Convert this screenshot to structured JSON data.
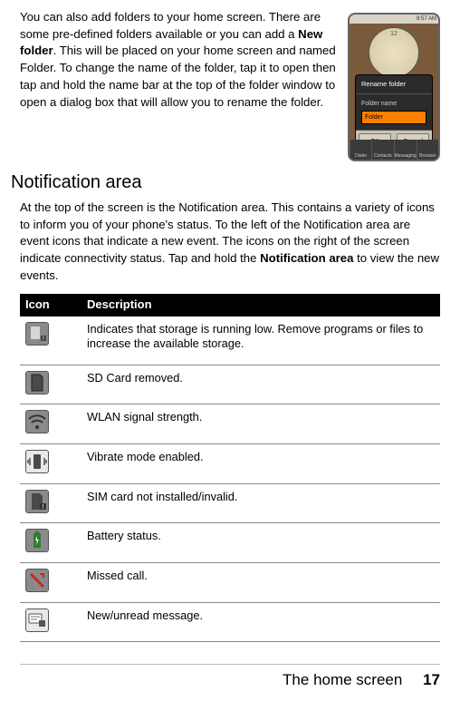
{
  "intro": {
    "text_before_bold": "You can also add folders to your home screen. There are some pre-defined folders available or you can add a ",
    "bold": "New folder",
    "text_after_bold": ". This will be placed on your home screen and named Folder. To change the name of the folder, tap it to open then tap and hold the name bar at the top of the folder window to open a dialog box that will allow you to rename the folder."
  },
  "heading": "Notification area",
  "body": {
    "text_before_bold": "At the top of the screen is the Notification area. This contains a variety of icons to inform you of your phone's status. To the left of the Notification area are event icons that indicate a new event. The icons on the right of the screen indicate connectivity status. Tap and hold the ",
    "bold": "Notification area",
    "text_after_bold": " to view the new events."
  },
  "table": {
    "col_icon": "Icon",
    "col_desc": "Description",
    "rows": [
      {
        "icon": "storage-low-icon",
        "desc": "Indicates that storage is running low. Remove programs or files to increase the available storage."
      },
      {
        "icon": "sd-removed-icon",
        "desc": "SD Card removed."
      },
      {
        "icon": "wlan-icon",
        "desc": "WLAN signal strength."
      },
      {
        "icon": "vibrate-icon",
        "desc": "Vibrate mode enabled."
      },
      {
        "icon": "sim-invalid-icon",
        "desc": "SIM card not installed/invalid."
      },
      {
        "icon": "battery-icon",
        "desc": "Battery status."
      },
      {
        "icon": "missed-call-icon",
        "desc": "Missed call."
      },
      {
        "icon": "new-message-icon",
        "desc": "New/unread message."
      }
    ]
  },
  "phone": {
    "status_time": "8:57 AM",
    "clock12": "12",
    "dialog_title": "Rename folder",
    "dialog_label": "Folder name",
    "dialog_value": "Folder",
    "ok": "OK",
    "cancel": "Cancel",
    "dock": [
      "Dialer",
      "Contacts",
      "Messaging",
      "Browser"
    ]
  },
  "footer": {
    "title": "The home screen",
    "page": "17"
  }
}
